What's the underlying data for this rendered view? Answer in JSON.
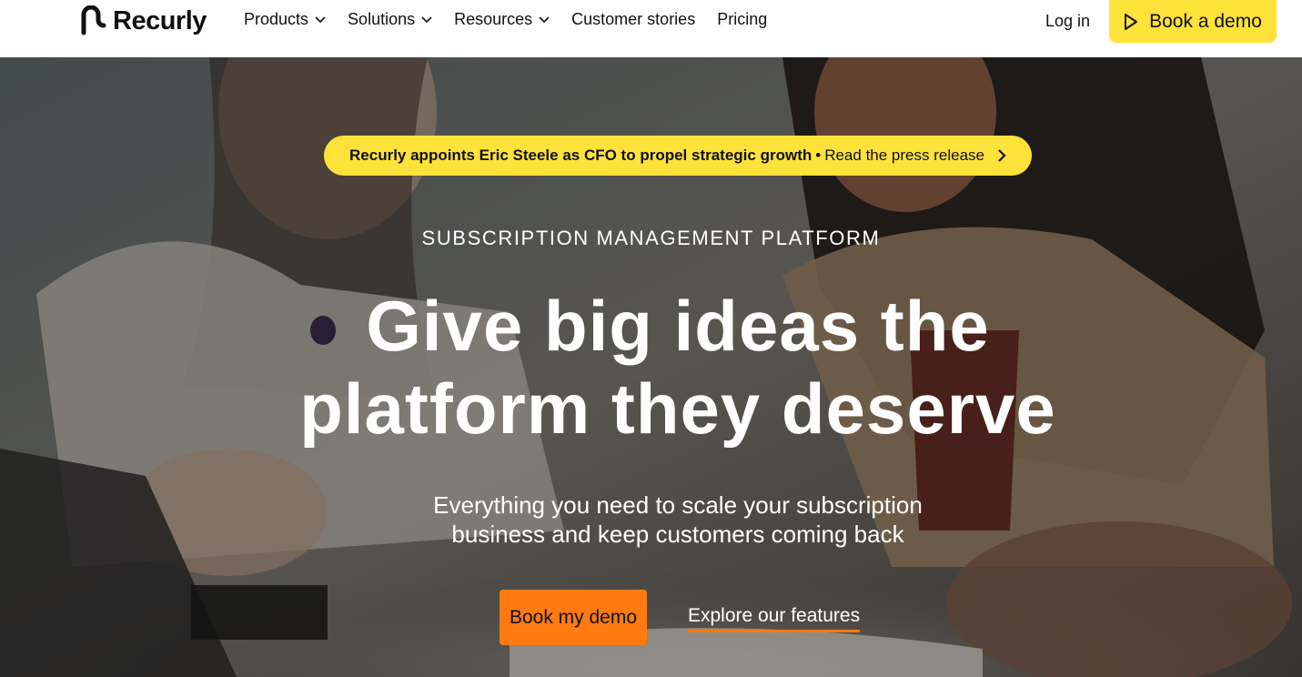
{
  "nav": {
    "logo_text": "Recurly",
    "items": [
      {
        "label": "Products",
        "has_dropdown": true
      },
      {
        "label": "Solutions",
        "has_dropdown": true
      },
      {
        "label": "Resources",
        "has_dropdown": true
      },
      {
        "label": "Customer stories",
        "has_dropdown": false
      },
      {
        "label": "Pricing",
        "has_dropdown": false
      }
    ],
    "login_label": "Log in",
    "demo_label": "Book a demo"
  },
  "hero": {
    "announcement": {
      "strong": "Recurly appoints Eric Steele as CFO to propel strategic growth",
      "separator": "•",
      "link": "Read the press release"
    },
    "eyebrow": "SUBSCRIPTION MANAGEMENT PLATFORM",
    "headline_line1": "Give big ideas the",
    "headline_line2": "platform they deserve",
    "subhead_line1": "Everything you need to scale your subscription",
    "subhead_line2": "business and keep customers coming back",
    "cta_primary": "Book my demo",
    "cta_secondary": "Explore our features"
  },
  "colors": {
    "accent_yellow": "#fde23a",
    "accent_orange": "#ff7a10",
    "text_dark": "#111111",
    "nav_bg": "#ffffff"
  },
  "icons": {
    "logo": "recurly-logo-icon",
    "dropdown": "chevron-down-icon",
    "play": "play-icon",
    "arrow": "chevron-right-icon"
  }
}
